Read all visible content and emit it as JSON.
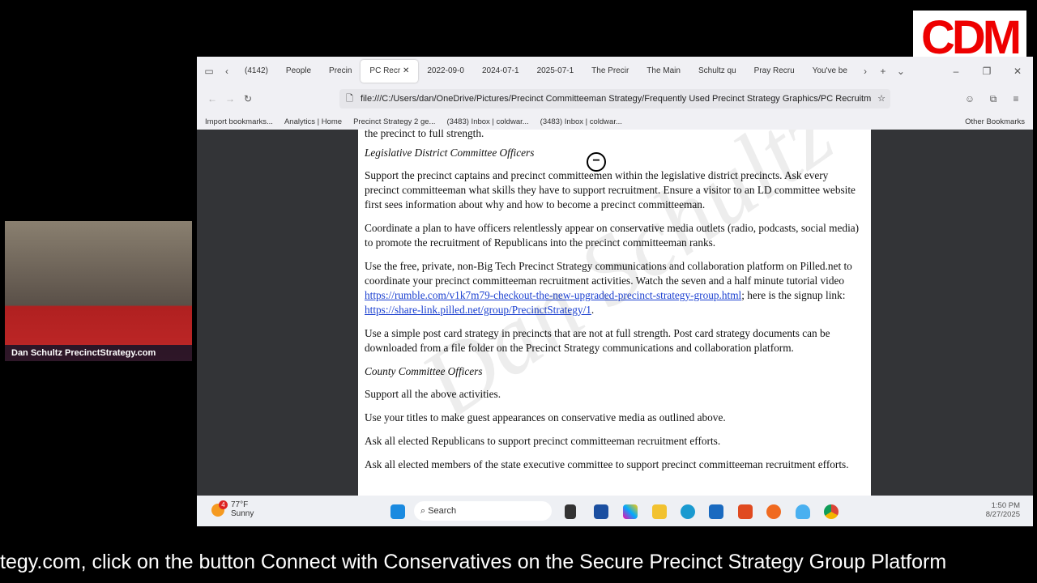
{
  "browser": {
    "tabs": [
      "(4142)",
      "People",
      "Precin",
      "PC Recr",
      "2022-09-0",
      "2024-07-1",
      "2025-07-1",
      "The Precir",
      "The Main",
      "Schultz qu",
      "Pray Recru",
      "You've be"
    ],
    "active_tab": 3,
    "url": "file:///C:/Users/dan/OneDrive/Pictures/Precinct Committeeman Strategy/Frequently Used Precinct Strategy Graphics/PC Recruitm",
    "bookmarks": [
      "Import bookmarks...",
      "Analytics | Home",
      "Precinct Strategy 2 ge...",
      "(3483) Inbox | coldwar...",
      "(3483) Inbox | coldwar..."
    ],
    "other_bookmarks": "Other Bookmarks"
  },
  "document": {
    "top_fragment": "the precinct to full strength.",
    "heading1": "Legislative District Committee Officers",
    "p1": "Support the precinct captains and precinct committeemen within the legislative district precincts.  Ask every precinct committeeman what skills they have to support recruitment.  Ensure a visitor to an LD committee website first sees information about why and how to become a precinct committeeman.",
    "p2": "Coordinate a plan to have officers relentlessly appear on conservative media outlets (radio, podcasts, social media) to promote the recruitment of Republicans into the precinct committeeman ranks.",
    "p3_a": "Use the free, private, non-Big Tech Precinct Strategy communications and collaboration platform on Pilled.net to coordinate your precinct committeeman recruitment activities.  Watch the seven and a half minute tutorial video ",
    "p3_link1": "https://rumble.com/v1k7m79-checkout-the-new-upgraded-precinct-strategy-group.html",
    "p3_b": "; here is the signup link:  ",
    "p3_link2": "https://share-link.pilled.net/group/PrecinctStrategy/1",
    "p3_c": ".",
    "p4": "Use a simple post card strategy in precincts that are not at full strength.  Post card strategy documents can be downloaded from a file folder on the Precinct Strategy communications and collaboration platform.",
    "heading2": "County Committee Officers",
    "p5": "Support all the above activities.",
    "p6": "Use your titles to make guest appearances on conservative media as outlined above.",
    "p7": "Ask all elected Republicans to support precinct committeeman recruitment efforts.",
    "p8": "Ask all elected members of the state executive committee to support precinct committeeman recruitment efforts.",
    "watermark": "Dan Schultz"
  },
  "taskbar": {
    "weather_temp": "77°F",
    "weather_cond": "Sunny",
    "weather_badge": "4",
    "search": "Search",
    "time": "1:50 PM",
    "date": "8/27/2025"
  },
  "overlay": {
    "cam_label": "Dan Schultz PrecinctStrategy.com",
    "logo": "CDM",
    "ticker": "tegy.com, click on the button Connect with Conservatives on the Secure Precinct Strategy Group Platform"
  }
}
